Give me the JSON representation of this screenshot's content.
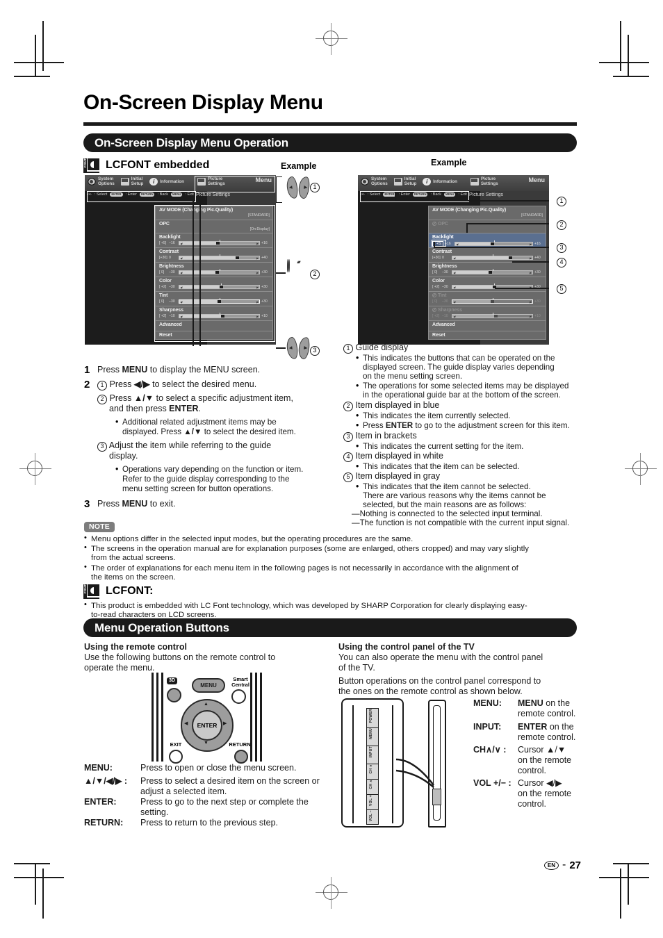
{
  "page": {
    "number": "27",
    "locale_badge": "EN",
    "separator": "-"
  },
  "title": "On-Screen Display Menu",
  "sections": {
    "operation_bar": "On-Screen Display Menu Operation",
    "buttons_bar": "Menu Operation Buttons"
  },
  "lcfont_embedded": {
    "label": "LCFONT embedded",
    "icon": "lcfont-logo",
    "badge_text": "FONT"
  },
  "example_label_left": "Example",
  "example_label_right": "Example",
  "osd": {
    "tabs": [
      {
        "label": "System\nOptions",
        "line1": "System",
        "line2": "Options",
        "icon": "gear-icon",
        "active": false
      },
      {
        "label": "Initial\nSetup",
        "line1": "Initial",
        "line2": "Setup",
        "icon": "monitor-icon",
        "active": false
      },
      {
        "label": "Information",
        "line1": "Information",
        "line2": "",
        "icon": "info-icon",
        "active": false
      },
      {
        "label": "Picture\nSettings",
        "line1": "Picture",
        "line2": "Settings",
        "icon": "monitor-icon",
        "active": true
      }
    ],
    "menu_word": "Menu",
    "guide": [
      {
        "key": "cursor",
        "glyph": "‹•›",
        "text": ": Select"
      },
      {
        "key": "ENTER",
        "text": ": Enter"
      },
      {
        "key": "RETURN",
        "text": ": Back"
      },
      {
        "key": "MENU",
        "text": ": Exit"
      }
    ],
    "subtitle": "Picture Settings",
    "rows": [
      {
        "name": "AV MODE (Changing Pic.Quality)",
        "bracket": "[STANDARD]",
        "type": "label"
      },
      {
        "name": "OPC",
        "bracket": "[On:Display]",
        "type": "label",
        "disabled_right": true
      },
      {
        "name": "Backlight",
        "value": "[ +5]",
        "min": "–16",
        "max": "+16",
        "fill": 46,
        "knob": 46,
        "tick": 50,
        "type": "slider"
      },
      {
        "name": "Contrast",
        "value": "[+30]",
        "min": "0",
        "max": "+40",
        "fill": 70,
        "knob": 70,
        "tick": 50,
        "type": "slider"
      },
      {
        "name": "Brightness",
        "value": "[  0]",
        "min": "–30",
        "max": "+30",
        "fill": 45,
        "knob": 45,
        "tick": 50,
        "type": "slider"
      },
      {
        "name": "Color",
        "value": "[ +2]",
        "min": "–30",
        "max": "+30",
        "fill": 50,
        "knob": 50,
        "tick": 52,
        "type": "slider"
      },
      {
        "name": "Tint",
        "value": "[  0]",
        "min": "–30",
        "max": "+30",
        "fill": 48,
        "knob": 48,
        "tick": 50,
        "type": "slider",
        "arrows": true
      },
      {
        "name": "Sharpness",
        "value": "[ +2]",
        "min": "–10",
        "max": "+10",
        "fill": 52,
        "knob": 52,
        "tick": 50,
        "type": "slider"
      },
      {
        "name": "Advanced",
        "type": "plain"
      },
      {
        "name": "Reset",
        "type": "plain"
      }
    ]
  },
  "callouts_left": [
    "1",
    "2",
    "3"
  ],
  "callouts_right": [
    "1",
    "2",
    "3",
    "4",
    "5"
  ],
  "steps": [
    {
      "n": "1",
      "text_before": "Press ",
      "bold": "MENU",
      "text_after": " to display the MENU screen."
    },
    {
      "n": "2"
    },
    {
      "n": "3",
      "text_before": "Press ",
      "bold": "MENU",
      "text_after": " to exit."
    }
  ],
  "step2": {
    "a_pre": "Press ",
    "a_keys": "◀/▶",
    "a_post": " to select the desired menu.",
    "b_pre": "Press ",
    "b_keys": "▲/▼",
    "b_post": " to select a specific adjustment item,",
    "b_l2_pre": "and then press ",
    "b_l2_bold": "ENTER",
    "b_l2_post": ".",
    "b_bullet_l1": "Additional related adjustment items may be",
    "b_bullet_l2_pre": "displayed. Press ",
    "b_bullet_keys": "▲/▼",
    "b_bullet_l2_post": " to select the desired item.",
    "c_l1": "Adjust the item while referring to the guide",
    "c_l2": "display.",
    "c_bullet_l1": "Operations vary depending on the function or item.",
    "c_bullet_l2": "Refer to the guide display corresponding to the",
    "c_bullet_l3": "menu setting screen for button operations."
  },
  "legend": [
    {
      "n": "1",
      "head": "Guide display",
      "bullets": [
        [
          "This indicates the buttons that can be operated on the",
          "displayed screen. The guide display varies depending",
          "on the menu setting screen."
        ],
        [
          "The operations for some selected items may be displayed",
          "in the operational guide bar at the bottom of the screen."
        ]
      ]
    },
    {
      "n": "2",
      "head": "Item displayed in blue",
      "bullets": [
        [
          "This indicates the item currently selected."
        ],
        [
          "Press ENTER to go to the adjustment screen for this item."
        ]
      ],
      "bold_in_bullet": "ENTER"
    },
    {
      "n": "3",
      "head": "Item in brackets",
      "bullets": [
        [
          "This indicates the current setting for the item."
        ]
      ]
    },
    {
      "n": "4",
      "head": "Item displayed in white",
      "bullets": [
        [
          "This indicates that the item can be selected."
        ]
      ]
    },
    {
      "n": "5",
      "head": "Item displayed in gray",
      "bullets": [
        [
          "This indicates that the item cannot be selected.",
          "There are various reasons why the items cannot be",
          "selected, but the main reasons are as follows:"
        ]
      ],
      "dashes": [
        "—Nothing is connected to the selected input terminal.",
        "—The function is not compatible with the current input signal."
      ]
    }
  ],
  "note": {
    "label": "NOTE",
    "items": [
      [
        "Menu options differ in the selected input modes, but the operating procedures are the same."
      ],
      [
        "The screens in the operation manual are for explanation purposes (some are enlarged, others cropped) and may vary slightly",
        "from the actual screens."
      ],
      [
        "The order of explanations for each menu item in the following pages is not necessarily in accordance with the alignment of",
        "the items on the screen."
      ]
    ]
  },
  "lcfont_note": {
    "heading": "LCFONT:",
    "lines": [
      "This product is embedded with LC Font technology, which was developed by SHARP Corporation for clearly displaying easy-",
      "to-read characters on LCD screens."
    ]
  },
  "remote_section": {
    "heading": "Using the remote control",
    "intro": [
      "Use the following buttons on the remote control to",
      "operate the menu."
    ],
    "remote": {
      "btn_3d": "3D",
      "btn_menu": "MENU",
      "btn_smart_l1": "Smart",
      "btn_smart_l2": "Central",
      "btn_enter": "ENTER",
      "btn_exit": "EXIT",
      "btn_return": "RETURN",
      "arrow_up": "▲",
      "arrow_down": "▼",
      "arrow_left": "◀",
      "arrow_right": "▶"
    },
    "definitions": [
      {
        "term": "MENU:",
        "lines": [
          "Press to open or close the menu screen."
        ]
      },
      {
        "term": "▲/▼/◀/▶ :",
        "lines": [
          "Press to select a desired item on the screen or",
          "adjust a selected item."
        ]
      },
      {
        "term": "ENTER:",
        "lines": [
          "Press to go to the next step or complete the",
          "setting."
        ]
      },
      {
        "term": "RETURN:",
        "lines": [
          "Press to return to the previous step."
        ]
      }
    ]
  },
  "panel_section": {
    "heading": "Using the control panel of the TV",
    "intro": [
      "You can also operate the menu with the control panel",
      "of the TV.",
      "Button operations on the control panel correspond to",
      "the ones on the remote control as shown below."
    ],
    "panel_labels": [
      "POWER",
      "MENU",
      "INPUT",
      "CH ∨",
      "CH ∧",
      "VOL +",
      "VOL −"
    ],
    "mappings": [
      {
        "term": "MENU:",
        "bold": "MENU",
        "l1_rest": " on the",
        "l2": "remote control."
      },
      {
        "term": "INPUT:",
        "bold": "ENTER",
        "l1_rest": " on the",
        "l2": "remote control."
      },
      {
        "term": "CH∧/∨ :",
        "bold": "",
        "l1_rest": "Cursor ▲/▼",
        "l2": "on the remote",
        "l3": "control."
      },
      {
        "term": "VOL +/− :",
        "bold": "",
        "l1_rest": "Cursor ◀/▶",
        "l2": "on the remote",
        "l3": "control."
      }
    ]
  }
}
